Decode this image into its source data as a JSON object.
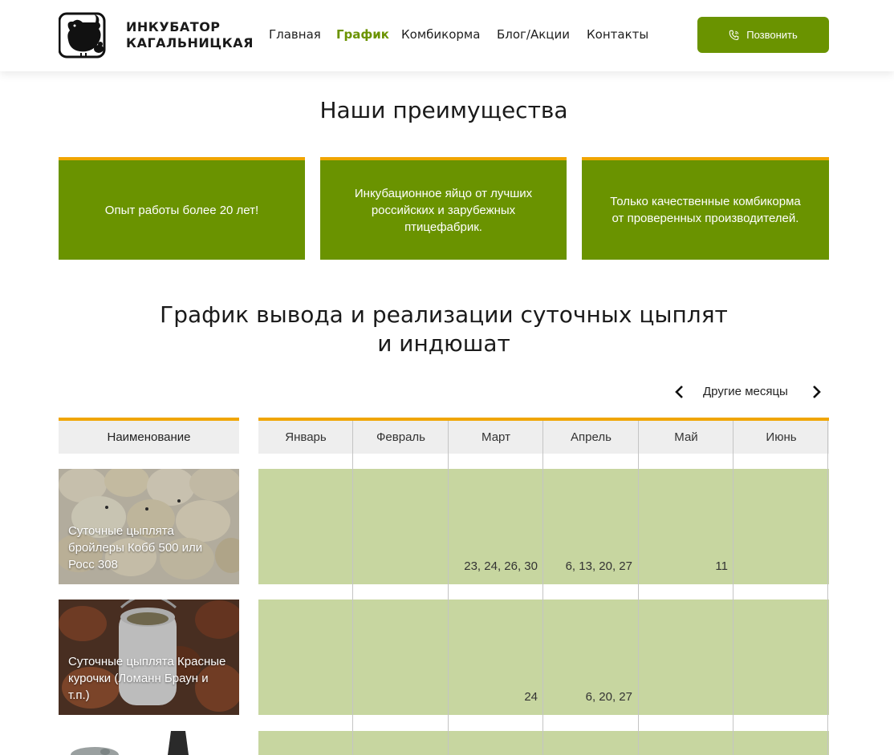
{
  "brand": {
    "line1": "ИНКУБАТОР",
    "line2": "КАГАЛЬНИЦКАЯ"
  },
  "nav": [
    {
      "label": "Главная",
      "active": false
    },
    {
      "label": "График",
      "active": true
    },
    {
      "label": "Комбикорма",
      "active": false
    },
    {
      "label": "Блог/Акции",
      "active": false
    },
    {
      "label": "Контакты",
      "active": false
    }
  ],
  "call_button": {
    "label": "Позвонить"
  },
  "advantages": {
    "title": "Наши преимущества",
    "cards": [
      {
        "text": "Опыт работы более 20 лет!"
      },
      {
        "text": "Инкубационное яйцо от лучших российских и зарубежных птицефабрик."
      },
      {
        "text": "Только качественные комбикорма от проверенных производителей."
      }
    ]
  },
  "schedule": {
    "title_line1": "График вывода и реализации суточных цыплят",
    "title_line2": "и индюшат",
    "other_months": "Другие месяцы",
    "name_header": "Наименование",
    "months": [
      "Январь",
      "Февраль",
      "Март",
      "Апрель",
      "Май",
      "Июнь"
    ],
    "rows": [
      {
        "name": "Суточные цыплята бройлеры Кобб 500 или Росс 308",
        "values": [
          "",
          "",
          "23, 24, 26, 30",
          "6, 13, 20, 27",
          "11",
          ""
        ]
      },
      {
        "name": "Суточные цыплята Красные курочки (Ломанн Браун и т.п.)",
        "values": [
          "",
          "",
          "24",
          "6, 20, 27",
          "",
          ""
        ]
      }
    ]
  },
  "colors": {
    "green": "#6a9300",
    "accent": "#f0a500",
    "cell": "#c7d6a0"
  }
}
